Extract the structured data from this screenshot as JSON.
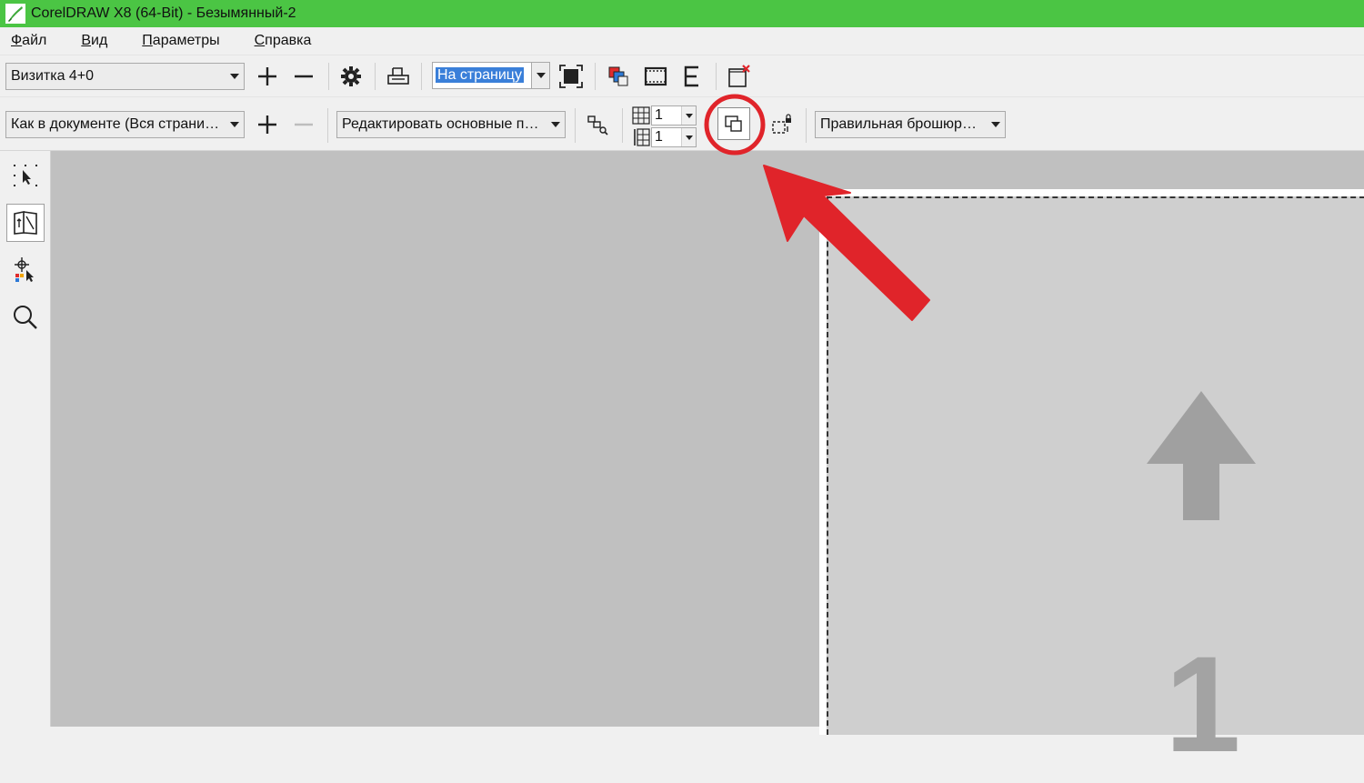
{
  "window": {
    "title": "CorelDRAW X8 (64-Bit) - Безымянный-2"
  },
  "menu": [
    "Файл",
    "Вид",
    "Параметры",
    "Справка"
  ],
  "toolbar1": {
    "preset": "Визитка 4+0",
    "zoom_value": "На страницу"
  },
  "toolbar2": {
    "print_mode": "Как в документе (Вся страни…",
    "edit_master": "Редактировать основные п…",
    "columns_value": "1",
    "rows_value": "1",
    "binding": "Правильная брошюр…"
  },
  "page": {
    "number": "1"
  },
  "colors": {
    "title_green": "#4bc544",
    "annotation_red": "#e0242a",
    "canvas": "#c0c0c0"
  }
}
